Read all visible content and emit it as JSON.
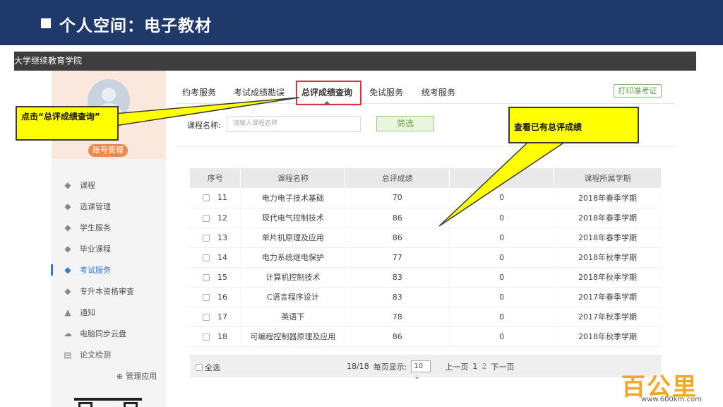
{
  "slide": {
    "title": "个人空间：电子教材"
  },
  "window": {
    "school_name": "大学继续教育学院"
  },
  "sidebar": {
    "account_button": "账号管理",
    "items": [
      {
        "label": "课程",
        "icon": "graduation-cap-icon",
        "active": false
      },
      {
        "label": "选课管理",
        "icon": "graduation-cap-icon",
        "active": false
      },
      {
        "label": "学生服务",
        "icon": "graduation-cap-icon",
        "active": false
      },
      {
        "label": "毕业课程",
        "icon": "graduation-cap-icon",
        "active": false
      },
      {
        "label": "考试服务",
        "icon": "graduation-cap-icon",
        "active": true
      },
      {
        "label": "专升本资格审查",
        "icon": "graduation-cap-icon",
        "active": false
      },
      {
        "label": "通知",
        "icon": "bell-icon",
        "active": false
      },
      {
        "label": "电脑同步云盘",
        "icon": "cloud-icon",
        "active": false
      },
      {
        "label": "论文检测",
        "icon": "document-search-icon",
        "active": false
      }
    ],
    "manage_apps": "管理应用"
  },
  "tabs": [
    "约考服务",
    "考试成绩勘误",
    "总评成绩查询",
    "免试服务",
    "统考服务"
  ],
  "active_tab": "总评成绩查询",
  "print_button": "打印准考证",
  "filter": {
    "label": "课程名称:",
    "placeholder": "请输入课程名称",
    "button": "筛选"
  },
  "table": {
    "columns": [
      "序号",
      "课程名称",
      "总评成绩",
      "",
      "课程所属学期"
    ],
    "rows": [
      {
        "no": "11",
        "course": "电力电子技术基础",
        "score": "70",
        "extra": "0",
        "term": "2018年春季学期"
      },
      {
        "no": "12",
        "course": "现代电气控制技术",
        "score": "86",
        "extra": "0",
        "term": "2018年春季学期"
      },
      {
        "no": "13",
        "course": "单片机原理及应用",
        "score": "86",
        "extra": "0",
        "term": "2018年春季学期"
      },
      {
        "no": "14",
        "course": "电力系统继电保护",
        "score": "77",
        "extra": "0",
        "term": "2018年秋季学期"
      },
      {
        "no": "15",
        "course": "计算机控制技术",
        "score": "83",
        "extra": "0",
        "term": "2018年秋季学期"
      },
      {
        "no": "16",
        "course": "C语言程序设计",
        "score": "83",
        "extra": "0",
        "term": "2017年春季学期"
      },
      {
        "no": "17",
        "course": "英语下",
        "score": "78",
        "extra": "0",
        "term": "2017年秋季学期"
      },
      {
        "no": "18",
        "course": "可编程控制器原理及应用",
        "score": "86",
        "extra": "0",
        "term": "2018年秋季学期"
      }
    ]
  },
  "footer": {
    "select_all": "全选",
    "count": "18/18",
    "per_page_label": "每页显示:",
    "per_page_value": "10 ⌄",
    "prev": "上一页",
    "pages": [
      "1",
      "2"
    ],
    "next": "下一页"
  },
  "callouts": {
    "left": "点击“总评成绩查询”",
    "right": "查看已有总评成绩"
  },
  "watermark": {
    "brand": "百公里",
    "url": "www.600km.com"
  },
  "colors": {
    "header_bg": "#1f3a6a",
    "accent_blue": "#2f7bd3",
    "callout_yellow": "#ffff00",
    "highlight_red": "#d9343e",
    "green_button": "#6aa34a"
  }
}
